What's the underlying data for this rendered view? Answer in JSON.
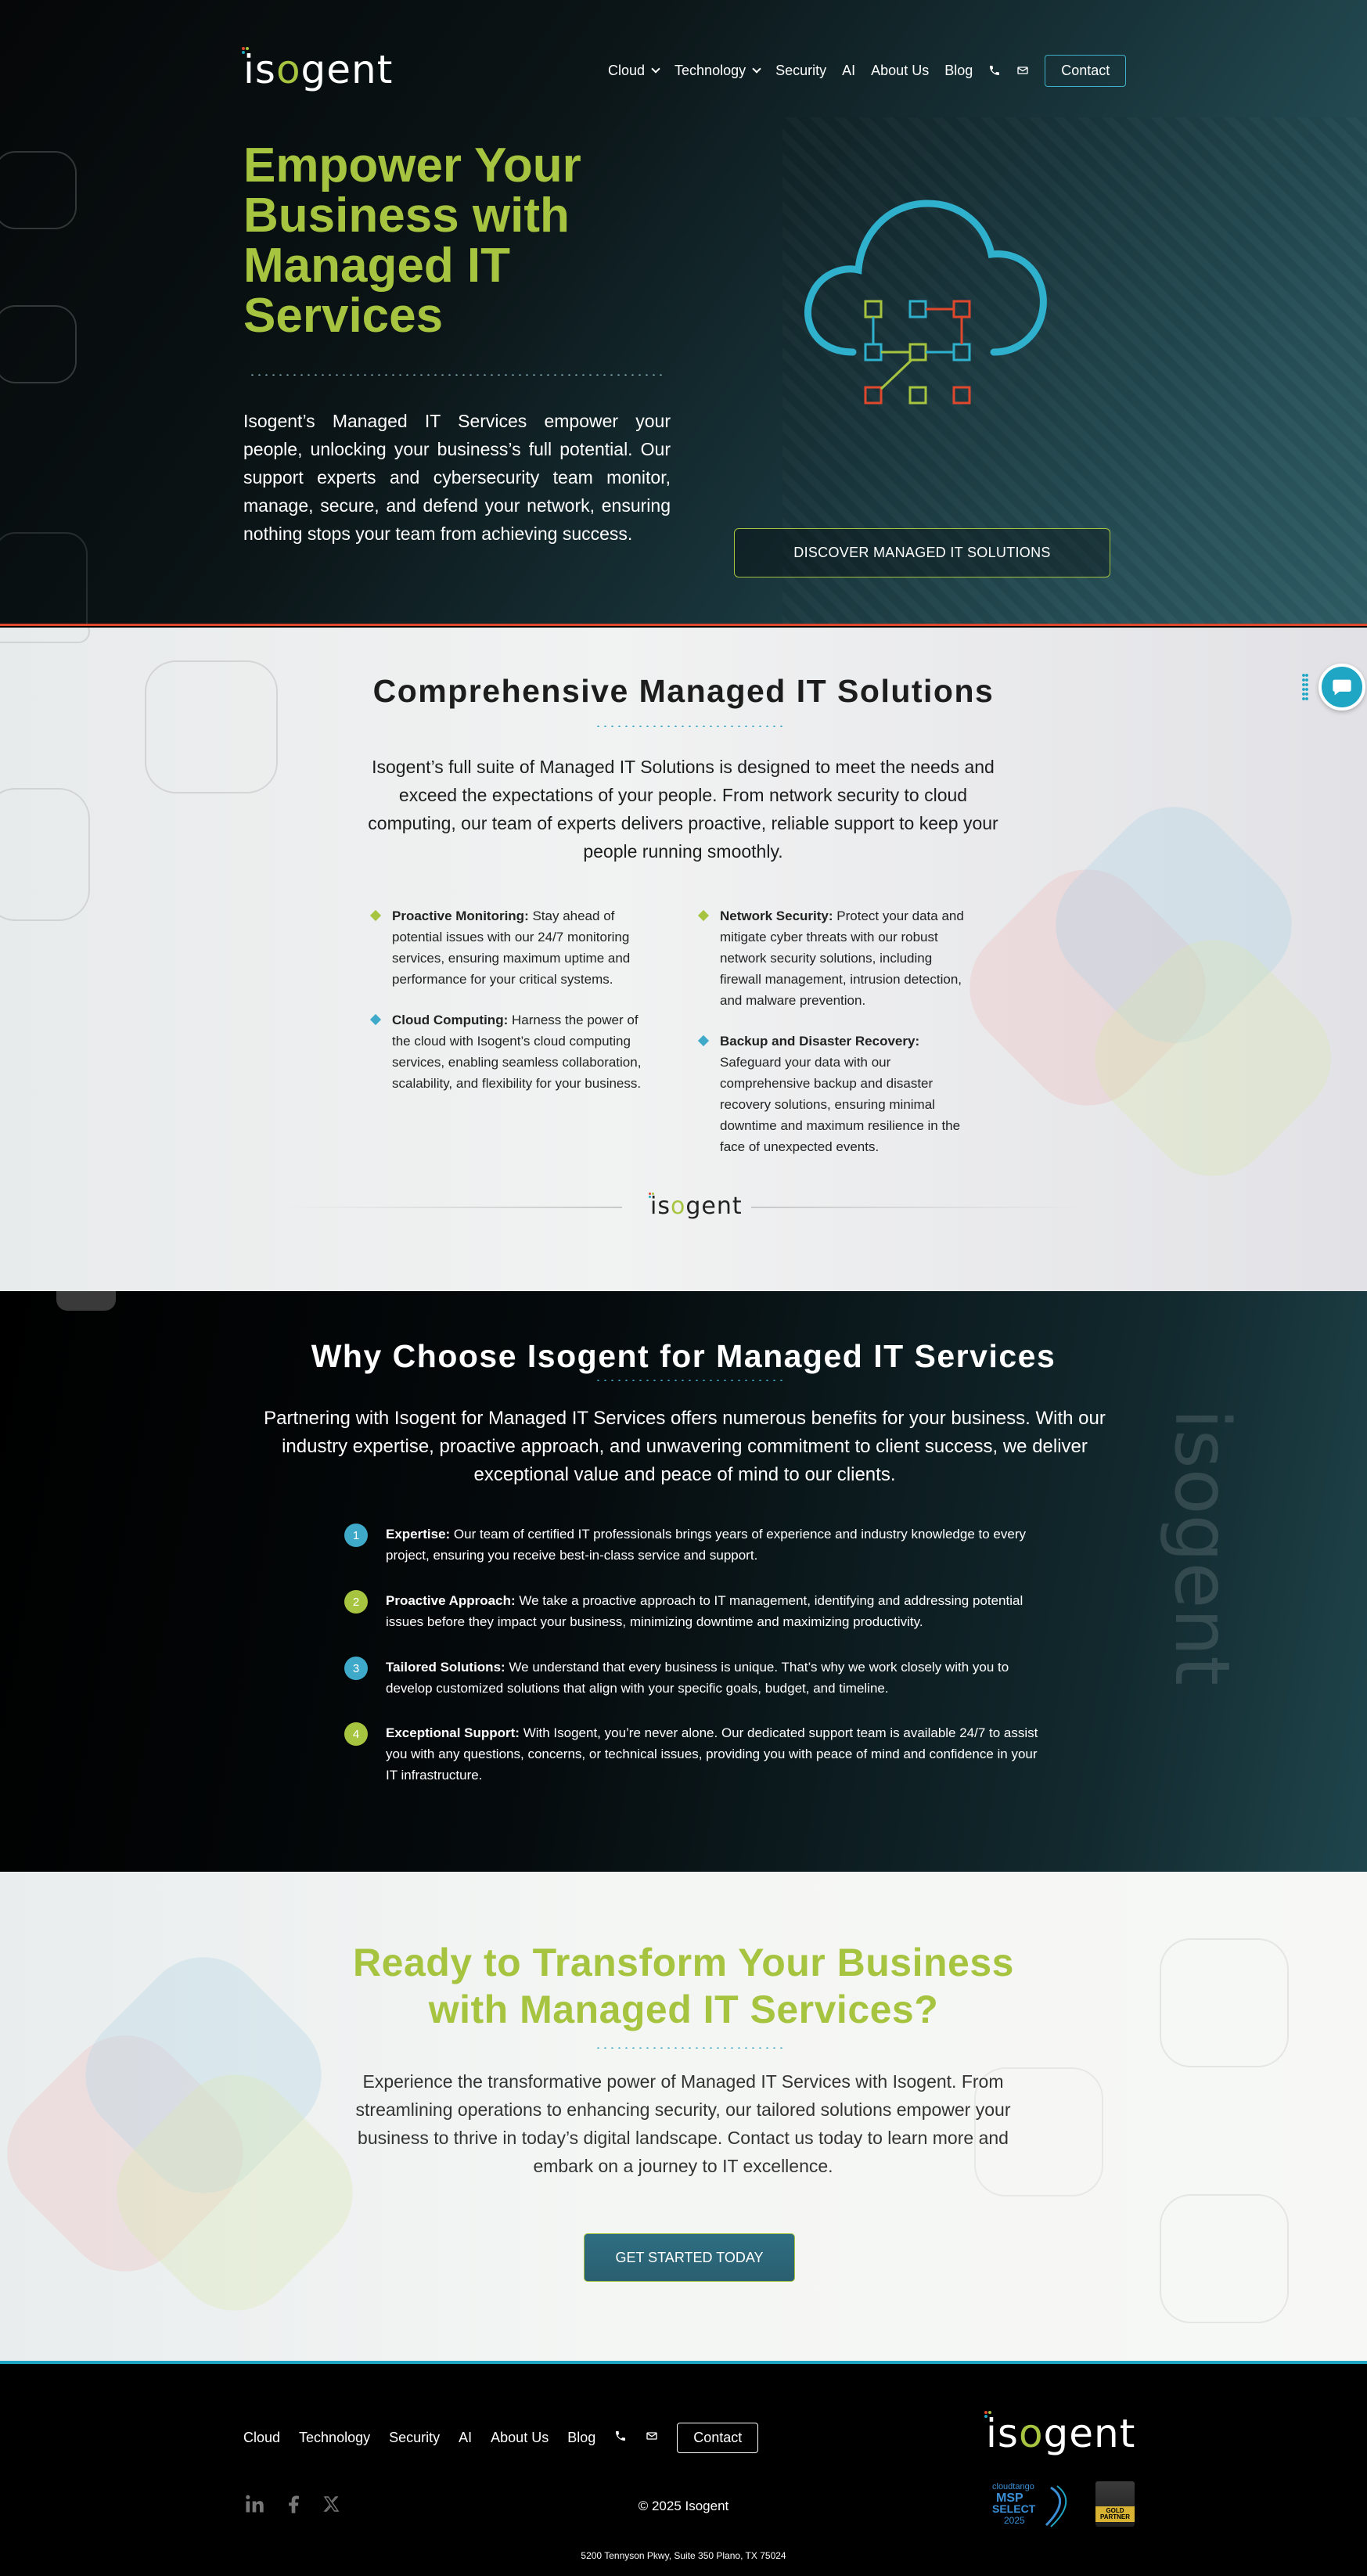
{
  "brand": {
    "logo_text_pre": "is",
    "logo_text_o": "o",
    "logo_text_post": "gent",
    "accent_green": "#a7c440",
    "accent_teal": "#1ea6c4",
    "accent_red": "#e0482e"
  },
  "nav": {
    "items": [
      {
        "label": "Cloud",
        "dropdown": true
      },
      {
        "label": "Technology",
        "dropdown": true
      },
      {
        "label": "Security",
        "dropdown": false
      },
      {
        "label": "AI",
        "dropdown": false
      },
      {
        "label": "About Us",
        "dropdown": false
      },
      {
        "label": "Blog",
        "dropdown": false
      }
    ],
    "phone_icon": "phone-icon",
    "mail_icon": "mail-icon",
    "contact_label": "Contact"
  },
  "hero": {
    "title": "Empower Your Business with Managed IT Services",
    "text": "Isogent’s Managed IT Services empower your people, unlocking your business’s full potential. Our support experts and cybersecurity team monitor, manage, secure, and defend your network, ensuring nothing stops your team from achieving success.",
    "button_label": "DISCOVER MANAGED IT SOLUTIONS",
    "illustration_icon": "cloud-network-icon"
  },
  "solutions": {
    "title": "Comprehensive Managed IT Solutions",
    "intro": "Isogent’s full suite of Managed IT Solutions is designed to meet the needs and exceed the expectations of your people. From network security to cloud computing, our team of experts delivers proactive, reliable support to keep your people running smoothly.",
    "features": [
      {
        "title": "Proactive Monitoring:",
        "text": " Stay ahead of potential issues with our 24/7 monitoring services, ensuring maximum uptime and performance for your critical systems.",
        "color": "#a7c440"
      },
      {
        "title": "Cloud Computing:",
        "text": " Harness the power of the cloud with Isogent’s cloud computing services, enabling seamless collaboration, scalability, and flexibility for your business.",
        "color": "#3fa9c9"
      },
      {
        "title": "Network Security:",
        "text": " Protect your data and mitigate cyber threats with our robust network security solutions, including firewall management, intrusion detection, and malware prevention.",
        "color": "#a7c440"
      },
      {
        "title": "Backup and Disaster Recovery:",
        "text": " Safeguard your data with our comprehensive backup and disaster recovery solutions, ensuring minimal downtime and maximum resilience in the face of unexpected events.",
        "color": "#3fa9c9"
      }
    ]
  },
  "why": {
    "title": "Why Choose Isogent for Managed IT Services",
    "intro": "Partnering with Isogent for Managed IT Services offers numerous benefits for your business. With our industry expertise, proactive approach, and unwavering commitment to client success, we deliver exceptional value and peace of mind to our clients.",
    "reasons": [
      {
        "num": "1",
        "title": "Expertise:",
        "text": " Our team of certified IT professionals brings years of experience and industry knowledge to every project, ensuring you receive best-in-class service and support.",
        "color": "#3fa9c9"
      },
      {
        "num": "2",
        "title": "Proactive Approach:",
        "text": " We take a proactive approach to IT management, identifying and addressing potential issues before they impact your business, minimizing downtime and maximizing productivity.",
        "color": "#a7c440"
      },
      {
        "num": "3",
        "title": "Tailored Solutions:",
        "text": " We understand that every business is unique. That’s why we work closely with you to develop customized solutions that align with your specific goals, budget, and timeline.",
        "color": "#3fa9c9"
      },
      {
        "num": "4",
        "title": "Exceptional Support:",
        "text": " With Isogent, you’re never alone. Our dedicated support team is available 24/7 to assist you with any questions, concerns, or technical issues, providing you with peace of mind and confidence in your IT infrastructure.",
        "color": "#a7c440"
      }
    ],
    "watermark": "isogent"
  },
  "cta": {
    "title_line1": "Ready to Transform Your Business",
    "title_line2": "with Managed IT Services?",
    "text": "Experience the transformative power of Managed IT Services with Isogent. From streamlining operations to enhancing security, our tailored solutions empower your business to thrive in today’s digital landscape. Contact us today to learn more and embark on a journey to IT excellence.",
    "button_label": "GET STARTED TODAY"
  },
  "footer": {
    "nav": [
      "Cloud",
      "Technology",
      "Security",
      "AI",
      "About Us",
      "Blog"
    ],
    "contact_label": "Contact",
    "social_icons": [
      "linkedin-icon",
      "facebook-icon",
      "x-twitter-icon"
    ],
    "copyright": "© 2025 Isogent",
    "address": "5200 Tennyson Pkwy, Suite 350 Plano, TX 75024",
    "badge_cloudtango": {
      "brand": "cloudtango",
      "line1": "MSP",
      "line2": "SELECT",
      "year": "2025"
    },
    "badge_gold": "GOLD PARTNER"
  }
}
